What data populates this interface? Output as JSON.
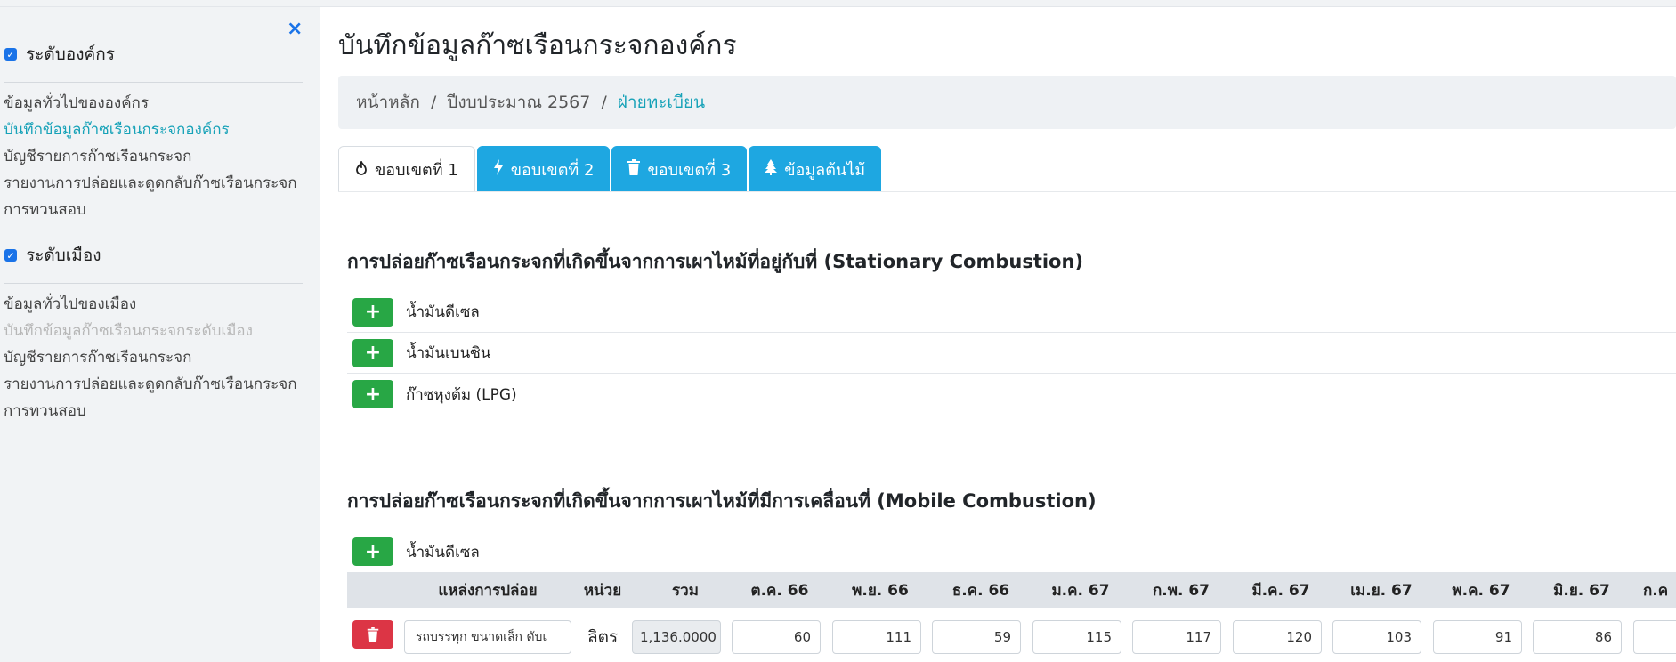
{
  "sidebar": {
    "close_icon": "×",
    "org_group": {
      "label": "ระดับองค์กร",
      "items": [
        "ข้อมูลทั่วไปขององค์กร",
        "บันทึกข้อมูลก๊าซเรือนกระจกองค์กร",
        "บัญชีรายการก๊าซเรือนกระจก",
        "รายงานการปล่อยและดูดกลับก๊าซเรือนกระจก",
        "การทวนสอบ"
      ]
    },
    "city_group": {
      "label": "ระดับเมือง",
      "items": [
        "ข้อมูลทั่วไปของเมือง",
        "บันทึกข้อมูลก๊าซเรือนกระจกระดับเมือง",
        "บัญชีรายการก๊าซเรือนกระจก",
        "รายงานการปล่อยและดูดกลับก๊าซเรือนกระจก",
        "การทวนสอบ"
      ]
    }
  },
  "page": {
    "title": "บันทึกข้อมูลก๊าซเรือนกระจกองค์กร"
  },
  "breadcrumb": {
    "items": [
      "หน้าหลัก",
      "ปีงบประมาณ 2567",
      "ฝ่ายทะเบียน"
    ],
    "separator": "/"
  },
  "tabs": [
    {
      "label": "ขอบเขตที่ 1",
      "icon": "fire-icon"
    },
    {
      "label": "ขอบเขตที่ 2",
      "icon": "bolt-icon"
    },
    {
      "label": "ขอบเขตที่ 3",
      "icon": "trash-icon"
    },
    {
      "label": "ข้อมูลต้นไม้",
      "icon": "tree-icon"
    }
  ],
  "stationary": {
    "title": "การปล่อยก๊าซเรือนกระจกที่เกิดขึ้นจากการเผาไหม้ที่อยู่กับที่ (Stationary Combustion)",
    "rows": [
      "น้ำมันดีเซล",
      "น้ำมันเบนซิน",
      "ก๊าซหุงต้ม (LPG)"
    ]
  },
  "mobile": {
    "title": "การปล่อยก๊าซเรือนกระจกที่เกิดขึ้นจากการเผาไหม้ที่มีการเคลื่อนที่ (Mobile Combustion)",
    "fuel_label": "น้ำมันดีเซล",
    "table": {
      "headers": [
        "แหล่งการปล่อย",
        "หน่วย",
        "รวม",
        "ต.ค. 66",
        "พ.ย. 66",
        "ธ.ค. 66",
        "ม.ค. 67",
        "ก.พ. 67",
        "มี.ค. 67",
        "เม.ย. 67",
        "พ.ค. 67",
        "มิ.ย. 67",
        "ก.ค"
      ],
      "row": {
        "source": "รถบรรทุก ขนาดเล็ก ดับเ",
        "unit": "ลิตร",
        "total": "1,136.0000",
        "values": [
          "60",
          "111",
          "59",
          "115",
          "117",
          "120",
          "103",
          "91",
          "86",
          ""
        ]
      }
    }
  },
  "colors": {
    "accent_tab": "#1ea7e1",
    "link_active": "#17a2b8",
    "add_button": "#28a745",
    "delete_button": "#dc3545"
  }
}
